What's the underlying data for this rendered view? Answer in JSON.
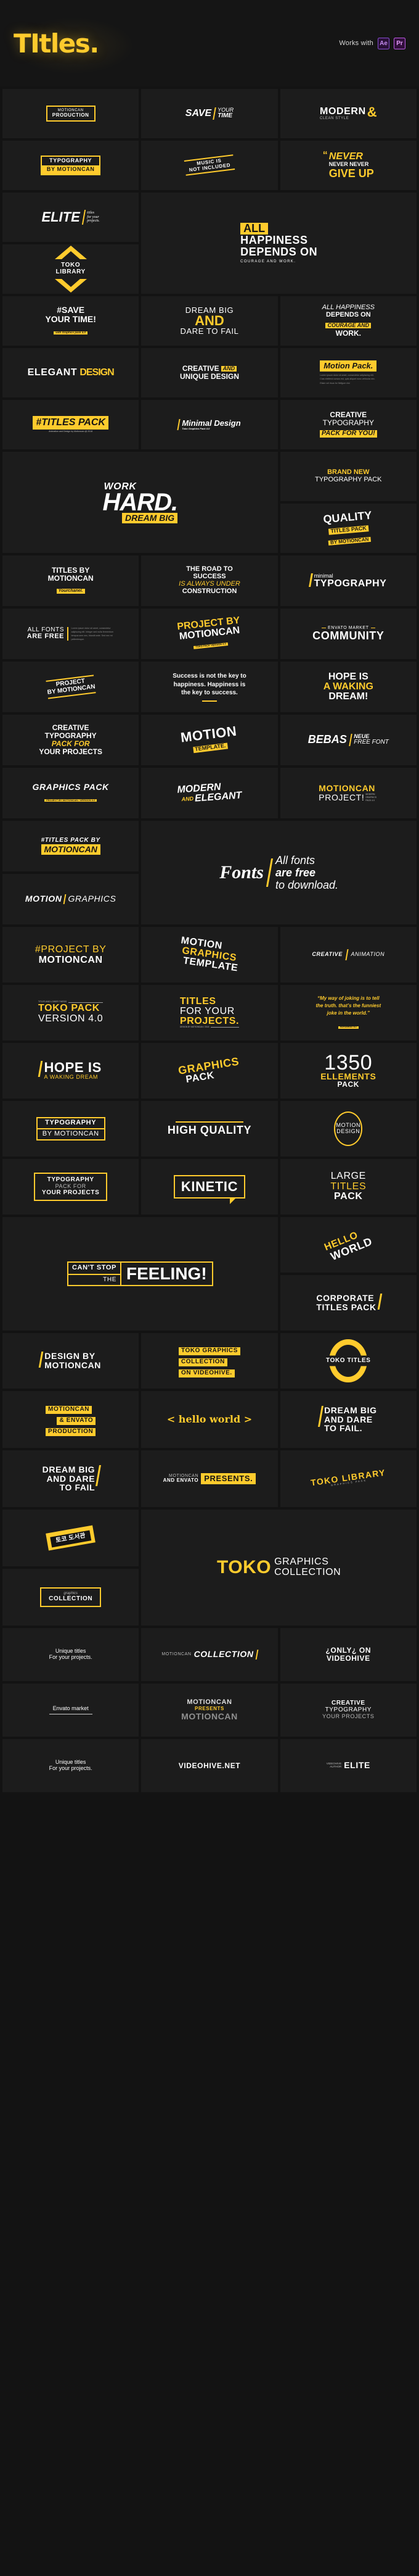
{
  "header": {
    "brand": "TItles.",
    "works_with_label": "Works with",
    "badges": [
      {
        "name": "after-effects",
        "label": "Ae"
      },
      {
        "name": "premiere-pro",
        "label": "Pr"
      }
    ],
    "accent_color": "#FFCB2D",
    "background_color": "#151515"
  },
  "theme": {
    "page_bg": "#131313",
    "tile_bg": "#1c1c1c",
    "accent": "#FFCB2D",
    "text": "#ffffff",
    "muted": "#b9b9b9"
  },
  "tiles": [
    {
      "id": "production",
      "lines": [
        "MOTIONCAN",
        "PRODUCTION"
      ]
    },
    {
      "id": "save-your-time",
      "lines": [
        "SAVE",
        "YOUR",
        "TIME"
      ]
    },
    {
      "id": "modern-clean-style",
      "lines": [
        "MODERN",
        "&",
        "CLEAN STYLE"
      ]
    },
    {
      "id": "typography-by-motioncan",
      "lines": [
        "TYPOGRAPHY",
        "BY MOTIONCAN"
      ]
    },
    {
      "id": "music-not-included",
      "lines": [
        "MUSIC IS",
        "NOT INCLUDED"
      ]
    },
    {
      "id": "never-give-up",
      "lines": [
        "NEVER",
        "NEVER NEVER",
        "GIVE UP"
      ]
    },
    {
      "id": "elite-titles",
      "lines": [
        "ELITE",
        "titles",
        "for your",
        "projects."
      ]
    },
    {
      "id": "all-happiness-depends",
      "lines": [
        "ALL",
        "HAPPINESS",
        "DEPENDS ON",
        "COURAGE AND WORK."
      ]
    },
    {
      "id": "toko-library",
      "lines": [
        "TOKO LIBRARY"
      ]
    },
    {
      "id": "save-your-time-hash",
      "lines": [
        "#SAVE",
        "YOUR TIME!",
        "with Graphics pack 4.0"
      ]
    },
    {
      "id": "dream-big-and-dare",
      "lines": [
        "DREAM BIG",
        "AND",
        "DARE TO FAIL"
      ]
    },
    {
      "id": "all-happiness-courage",
      "lines": [
        "ALL HAPPINESS",
        "DEPENDS ON",
        "COURAGE AND",
        "WORK."
      ]
    },
    {
      "id": "elegant-design",
      "lines": [
        "ELEGANT",
        "DESIGN"
      ]
    },
    {
      "id": "creative-unique-design",
      "lines": [
        "CREATIVE",
        "AND",
        "UNIQUE DESIGN"
      ]
    },
    {
      "id": "motion-pack",
      "lines": [
        "Motion Pack.",
        "Lorem ipsum dolor sit amet, consectetur adipiscing elit. Cras eleifend cursus est, quis aliquet nunc vehicula nec. Etiam vel risus for fleifgum nisi"
      ]
    },
    {
      "id": "titles-pack-hash",
      "lines": [
        "#TITLES PACK",
        "Animation and Design by Motioncan @ 2018"
      ]
    },
    {
      "id": "minimal-design",
      "lines": [
        "Minimal Design",
        "Toko Graphics Pack 4.0"
      ]
    },
    {
      "id": "creative-typography-pack",
      "lines": [
        "CREATIVE",
        "TYPOGRAPHY",
        "PACK FOR YOU!"
      ]
    },
    {
      "id": "work-hard-dream-big",
      "lines": [
        "WORK",
        "HARD.",
        "DREAM BIG"
      ]
    },
    {
      "id": "brand-new-typography-pack",
      "lines": [
        "BRAND NEW",
        "TYPOGRAPHY PACK"
      ]
    },
    {
      "id": "quality-titles-pack",
      "lines": [
        "QUALITY",
        "TITLES PACK",
        "BY MOTIONCAN"
      ]
    },
    {
      "id": "titles-by-motioncan",
      "lines": [
        "TITLES BY",
        "MOTIONCAN",
        "Yourchanel."
      ]
    },
    {
      "id": "road-to-success",
      "lines": [
        "THE ROAD TO",
        "SUCCESS",
        "IS ALWAYS UNDER",
        "CONSTRUCTION"
      ]
    },
    {
      "id": "minimal-typography",
      "lines": [
        "minimal",
        "TYPOGRAPHY"
      ]
    },
    {
      "id": "all-fonts-are-free",
      "lines": [
        "ALL FONTS",
        "ARE FREE",
        "Lorem ipsum dolor sit amet, consectetur adipiscing elit. Integer sed nulla fermentum tempus sem nec, blandit ante. Sed nec mi pellentesque."
      ]
    },
    {
      "id": "project-by-motioncan-tilt",
      "lines": [
        "PROJECT BY",
        "MOTIONCAN",
        "TOKO PACK VERSION 4.0"
      ]
    },
    {
      "id": "envato-market-community",
      "lines": [
        "ENVATO MARKET",
        "COMMUNITY"
      ]
    },
    {
      "id": "project-by-motioncan-stripes",
      "lines": [
        "PROJECT",
        "BY MOTIONCAN"
      ]
    },
    {
      "id": "success-key-happiness",
      "lines": [
        "Success is not the key to happiness. Happiness is the key to success."
      ]
    },
    {
      "id": "hope-is-waking-dream",
      "lines": [
        "HOPE IS",
        "A WAKING",
        "DREAM!"
      ]
    },
    {
      "id": "creative-typography-projects",
      "lines": [
        "CREATIVE",
        "TYPOGRAPHY",
        "PACK FOR",
        "YOUR PROJECTS"
      ]
    },
    {
      "id": "motion-template",
      "lines": [
        "MOTION",
        "TEMPLATE."
      ]
    },
    {
      "id": "bebas-neue-free-font",
      "lines": [
        "BEBAS",
        "NEUE",
        "FREE FONT"
      ]
    },
    {
      "id": "graphics-pack",
      "lines": [
        "GRAPHICS PACK",
        "PROJECT BY MOTIONCAN / VERSION 4.0"
      ]
    },
    {
      "id": "modern-and-elegant",
      "lines": [
        "MODERN",
        "AND",
        "ELEGANT"
      ]
    },
    {
      "id": "motioncan-project",
      "lines": [
        "MOTIONCAN",
        "PROJECT!",
        "MODERN GRAPHICS PACK 4.0"
      ]
    },
    {
      "id": "titles-pack-by-motioncan",
      "lines": [
        "#TITLES PACK BY",
        "MOTIONCAN"
      ]
    },
    {
      "id": "fonts-all-free",
      "lines": [
        "Fonts",
        "All fonts",
        "are free",
        "to download."
      ]
    },
    {
      "id": "motion-graphics",
      "lines": [
        "MOTION",
        "GRAPHICS"
      ]
    },
    {
      "id": "project-by-motioncan-hash",
      "lines": [
        "#PROJECT BY",
        "MOTIONCAN"
      ]
    },
    {
      "id": "motion-graphics-template",
      "lines": [
        "MOTION",
        "GRAPHICS",
        "TEMPLATE"
      ]
    },
    {
      "id": "creative-animation",
      "lines": [
        "CREATIVE",
        "ANIMATION"
      ]
    },
    {
      "id": "toko-pack-version",
      "lines": [
        "TITLES AND LOWER THIRDS",
        "TOKO PACK",
        "VERSION 4.0"
      ]
    },
    {
      "id": "titles-for-your-projects",
      "lines": [
        "TITLES",
        "FOR YOUR",
        "PROJECTS.",
        "DESIGN BY MOTIONCAN / 2018"
      ]
    },
    {
      "id": "muhammad-ali-quote",
      "lines": [
        "“My way of joking is to tell the truth. that’s the funniest joke in the world.”",
        "MUHAMMAD ALI"
      ]
    },
    {
      "id": "hope-is-waking-dream-bar",
      "lines": [
        "HOPE IS",
        "A WAKING DREAM"
      ]
    },
    {
      "id": "graphics-pack-tilt",
      "lines": [
        "GRAPHICS",
        "PACK"
      ]
    },
    {
      "id": "1350-ellements-pack",
      "lines": [
        "1350",
        "ELLEMENTS",
        "PACK"
      ]
    },
    {
      "id": "typography-by-motioncan-outline",
      "lines": [
        "TYPOGRAPHY",
        "BY MOTIONCAN"
      ]
    },
    {
      "id": "high-quality",
      "lines": [
        "HIGH QUALITY"
      ]
    },
    {
      "id": "motion-design-oval",
      "lines": [
        "MOTION",
        "DESIGN"
      ]
    },
    {
      "id": "typography-pack-for-projects",
      "lines": [
        "TYPOGRAPHY",
        "PACK FOR",
        "YOUR PROJECTS"
      ]
    },
    {
      "id": "kinetic",
      "lines": [
        "KINETIC"
      ]
    },
    {
      "id": "large-titles-pack",
      "lines": [
        "LARGE",
        "TITLES",
        "PACK"
      ]
    },
    {
      "id": "cant-stop-the-feeling",
      "lines": [
        "CAN'T STOP",
        "THE",
        "FEELING!"
      ]
    },
    {
      "id": "hello-world-tilt",
      "lines": [
        "HELLO",
        "WORLD"
      ]
    },
    {
      "id": "corporate-titles-pack",
      "lines": [
        "CORPORATE",
        "TITLES PACK"
      ]
    },
    {
      "id": "design-by-motioncan",
      "lines": [
        "DESIGN BY",
        "MOTIONCAN"
      ]
    },
    {
      "id": "toko-graphics-collection",
      "lines": [
        "TOKO GRAPHICS",
        "COLLECTION",
        "ON VIDEOHIVE."
      ]
    },
    {
      "id": "toko-titles-ring",
      "lines": [
        "TOKO TITLES"
      ]
    },
    {
      "id": "motioncan-envato-production",
      "lines": [
        "MOTIONCAN",
        "& ENVATO",
        "PRODUCTION"
      ]
    },
    {
      "id": "hello-world-script",
      "lines": [
        "< hello world >"
      ]
    },
    {
      "id": "dream-big-dare-fail-left",
      "lines": [
        "DREAM BIG",
        "AND DARE",
        "TO FAIL."
      ]
    },
    {
      "id": "dream-big-dare-fail-right",
      "lines": [
        "DREAM BIG",
        "AND DARE",
        "TO FAIL"
      ]
    },
    {
      "id": "motioncan-envato-presents",
      "lines": [
        "MOTIONCAN",
        "AND ENVATO",
        "PRESENTS."
      ]
    },
    {
      "id": "toko-library-graphics-pack",
      "lines": [
        "TOKO LIBRARY",
        "GRAPHICS PACK"
      ]
    },
    {
      "id": "toko-korean",
      "lines": [
        "토코 도서관"
      ]
    },
    {
      "id": "toko-graphics-collection-big",
      "lines": [
        "TOKO",
        "GRAPHICS",
        "COLLECTION"
      ]
    },
    {
      "id": "graphics-collection-frame",
      "lines": [
        "graphics",
        "COLLECTION"
      ]
    },
    {
      "id": "unique-titles-1",
      "lines": [
        "Unique titles",
        "For your projects."
      ]
    },
    {
      "id": "motioncan-collection",
      "lines": [
        "MOTIONCAN",
        "COLLECTION"
      ]
    },
    {
      "id": "only-on-videohive",
      "lines": [
        "¿ONLY¿ ON",
        "VIDEOHIVE"
      ]
    },
    {
      "id": "envato-market",
      "lines": [
        "Envato market"
      ]
    },
    {
      "id": "motioncan-presents-big",
      "lines": [
        "MOTIONCAN",
        "PRESENTS",
        "MOTIONCAN"
      ]
    },
    {
      "id": "creative-typography-your-projects",
      "lines": [
        "CREATIVE",
        "TYPOGRAPHY",
        "YOUR PROJECTS"
      ]
    },
    {
      "id": "unique-titles-2",
      "lines": [
        "Unique titles",
        "For your projects."
      ]
    },
    {
      "id": "videohive-net",
      "lines": [
        "VIDEOHIVE.NET"
      ]
    },
    {
      "id": "videohive-elite",
      "lines": [
        "VIDEOHIVE",
        "AUTHOR",
        "ELITE"
      ]
    }
  ]
}
